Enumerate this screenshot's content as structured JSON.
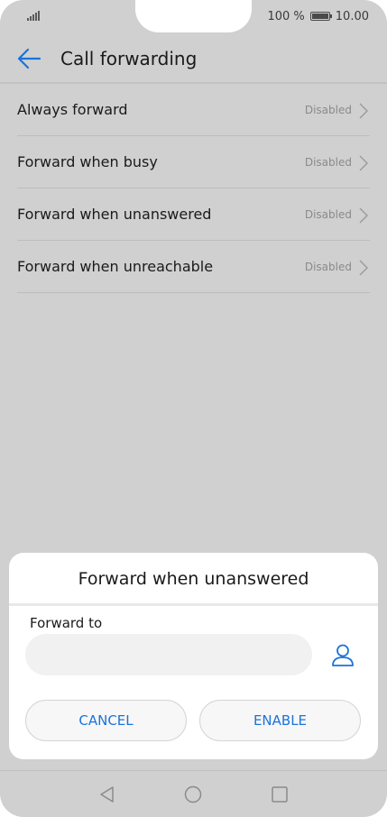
{
  "status_bar": {
    "battery_text": "100 %",
    "time": "10.00",
    "icons": [
      "signal-icon",
      "battery-icon"
    ]
  },
  "header": {
    "back_icon": "back-arrow-icon",
    "title": "Call forwarding"
  },
  "list": {
    "items": [
      {
        "label": "Always forward",
        "status": "Disabled"
      },
      {
        "label": "Forward when busy",
        "status": "Disabled"
      },
      {
        "label": "Forward when unanswered",
        "status": "Disabled"
      },
      {
        "label": "Forward when unreachable",
        "status": "Disabled"
      }
    ]
  },
  "dialog": {
    "title": "Forward when unanswered",
    "field_label": "Forward to",
    "input_value": "",
    "contact_icon": "contact-person-icon",
    "cancel_label": "CANCEL",
    "enable_label": "ENABLE"
  },
  "nav_bar": {
    "icons": [
      "nav-back-icon",
      "nav-home-icon",
      "nav-recents-icon"
    ]
  },
  "colors": {
    "accent": "#1a73d9",
    "overlay_bg": "#d0d0d0",
    "dialog_bg": "#ffffff"
  }
}
